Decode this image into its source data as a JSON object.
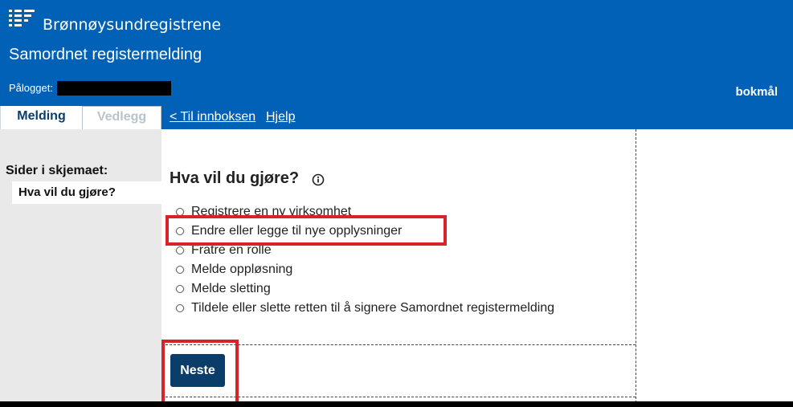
{
  "header": {
    "logo_icon": "brreg-logo-icon",
    "brand": "Brønnøysundregistrene",
    "app_title": "Samordnet registermelding",
    "logged_in_label": "Pålogget:",
    "language": "bokmål"
  },
  "tabs": [
    {
      "label": "Melding",
      "active": true
    },
    {
      "label": "Vedlegg",
      "active": false
    }
  ],
  "nav": {
    "inbox": "< Til innboksen",
    "help": "Hjelp"
  },
  "sidebar": {
    "title": "Sider i skjemaet:",
    "items": [
      {
        "label": "Hva vil du gjøre?",
        "selected": true
      }
    ]
  },
  "main": {
    "question": "Hva vil du gjøre?",
    "info_icon": "info-icon",
    "options": [
      {
        "label": "Registrere en ny virksomhet"
      },
      {
        "label": "Endre eller legge til nye opplysninger"
      },
      {
        "label": "Fratre en rolle"
      },
      {
        "label": "Melde oppløsning"
      },
      {
        "label": "Melde sletting"
      },
      {
        "label": "Tildele eller slette retten til å signere Samordnet registermelding"
      }
    ],
    "next_button": "Neste"
  },
  "colors": {
    "header_blue": "#0061b6",
    "dark_blue": "#0b3d6b",
    "highlight_red": "#d8232a"
  }
}
